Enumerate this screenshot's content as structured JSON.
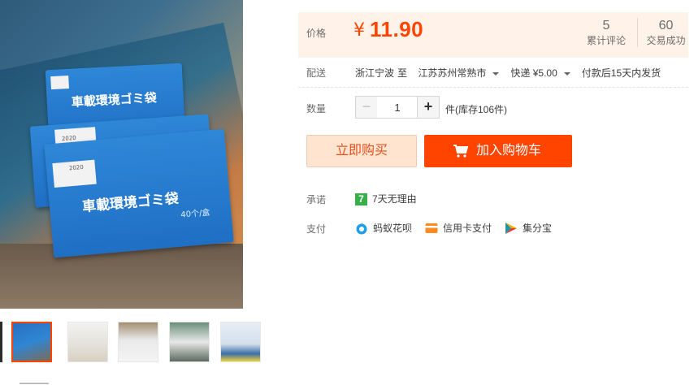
{
  "gallery": {
    "main_image": {
      "alt": "車載環境ゴミ袋",
      "bag_title": "車載環境ゴミ袋",
      "bag_count": "40个/盒",
      "year": "2020"
    },
    "thumbnails": [
      {
        "name": "thumb-1",
        "active": true
      },
      {
        "name": "thumb-2",
        "active": false
      },
      {
        "name": "thumb-3",
        "active": false
      },
      {
        "name": "thumb-4",
        "active": false
      },
      {
        "name": "thumb-5",
        "active": false
      }
    ]
  },
  "price": {
    "label": "价格",
    "symbol": "¥",
    "value": "11.90",
    "reviews_count": "5",
    "reviews_label": "累计评论",
    "sales_count": "60",
    "sales_label": "交易成功"
  },
  "delivery": {
    "label": "配送",
    "from": "浙江宁波",
    "to_word": "至",
    "destination": "江苏苏州常熟市",
    "shipping": "快递 ¥5.00",
    "ship_note": "付款后15天内发货"
  },
  "quantity": {
    "label": "数量",
    "minus": "−",
    "value": "1",
    "plus": "+",
    "unit_stock": "件(库存106件)"
  },
  "actions": {
    "buy_now": "立即购买",
    "add_to_cart": "加入购物车"
  },
  "promise": {
    "label": "承诺",
    "icon_text": "7",
    "text": "7天无理由"
  },
  "payment": {
    "label": "支付",
    "methods": [
      {
        "icon": "huabei-icon",
        "text": "蚂蚁花呗"
      },
      {
        "icon": "credit-card-icon",
        "text": "信用卡支付"
      },
      {
        "icon": "jifenbao-icon",
        "text": "集分宝"
      }
    ]
  },
  "colors": {
    "accent": "#ff4400",
    "price": "#ff4400",
    "price_bg": "#fff2e8",
    "buy_now_bg": "#ffe4d0"
  }
}
